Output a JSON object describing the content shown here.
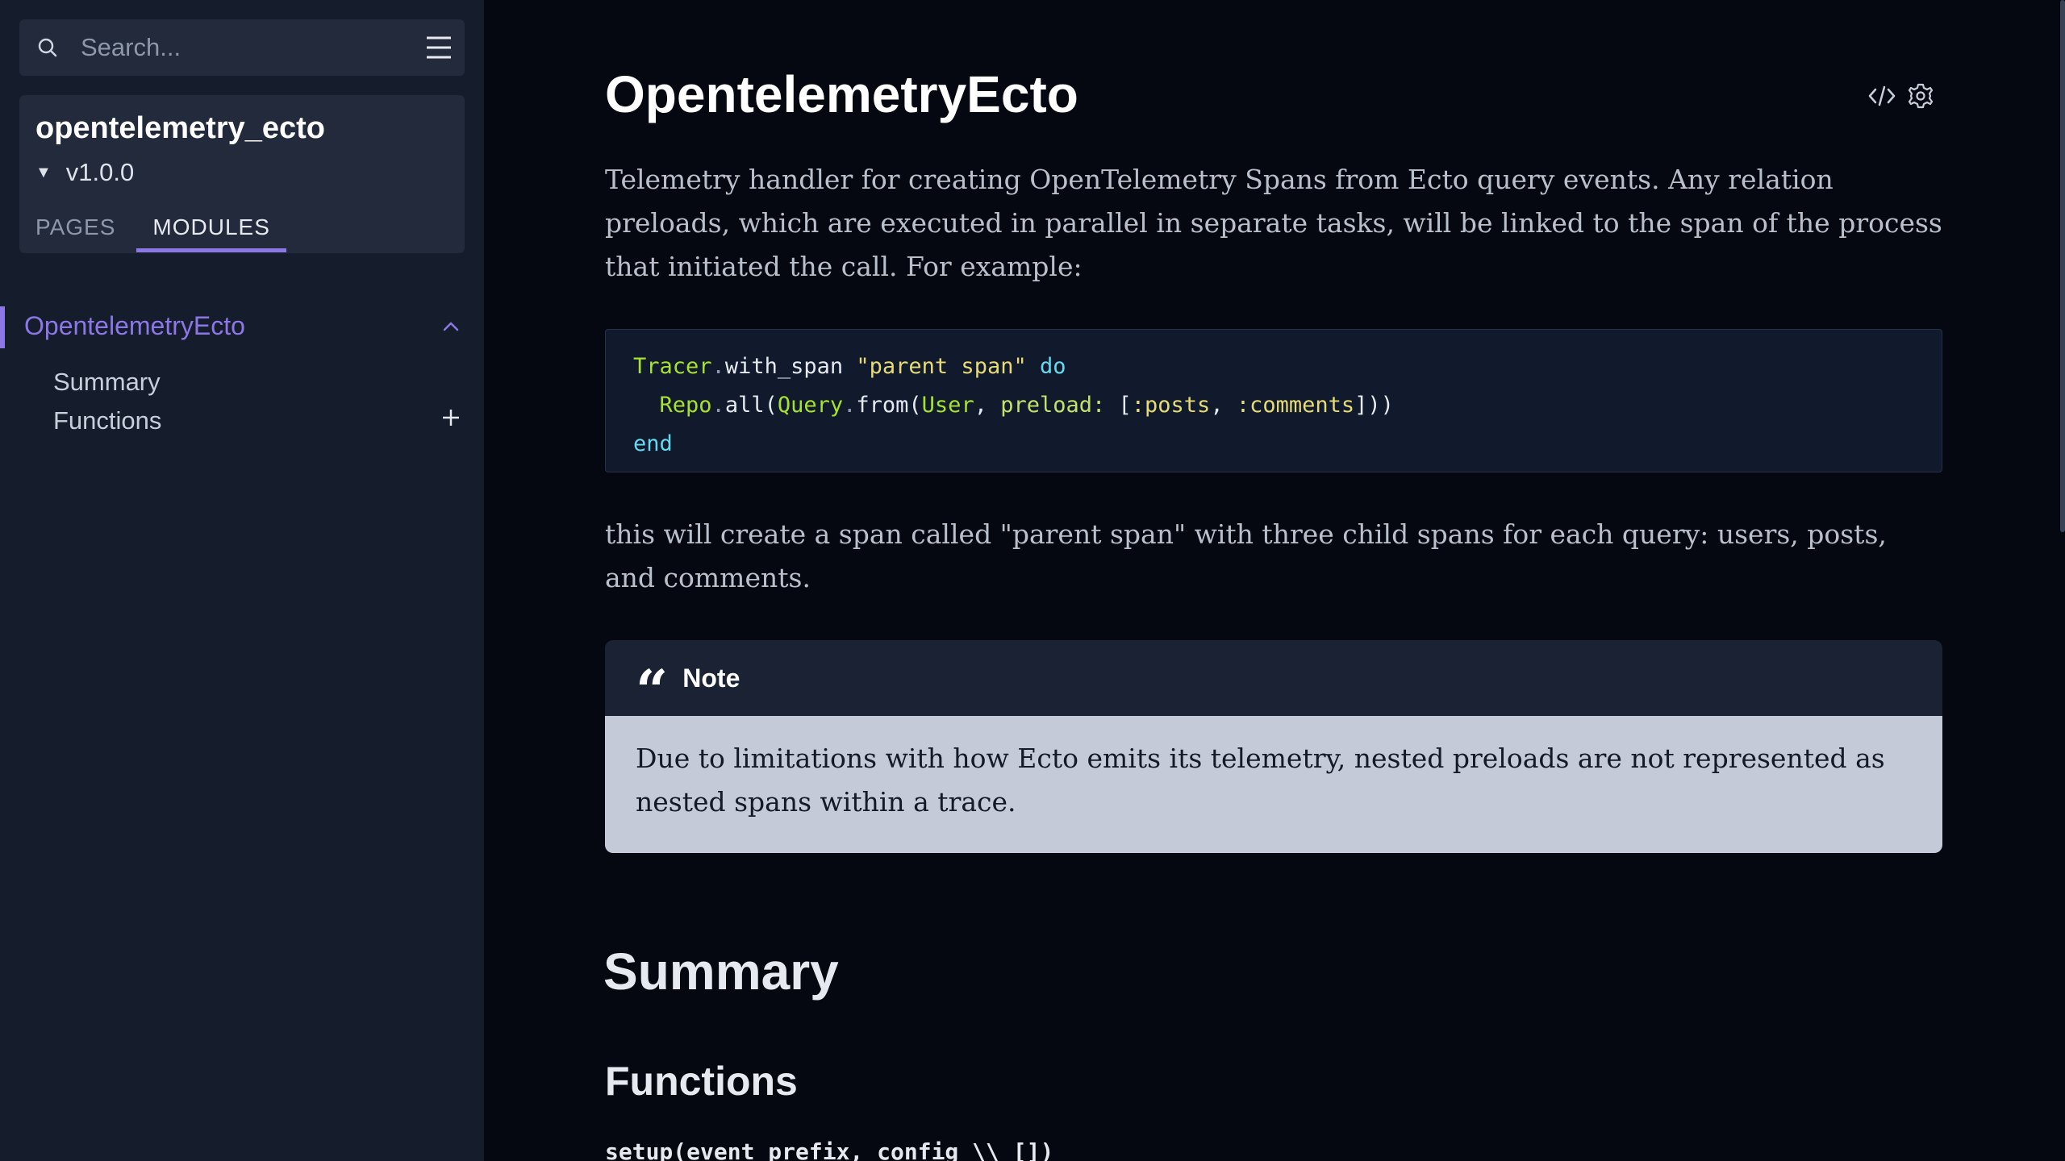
{
  "sidebar": {
    "search_placeholder": "Search...",
    "project_name": "opentelemetry_ecto",
    "version": "v1.0.0",
    "tabs": {
      "pages": "PAGES",
      "modules": "MODULES"
    },
    "module": "OpentelemetryEcto",
    "items": [
      {
        "label": "Summary"
      },
      {
        "label": "Functions"
      }
    ]
  },
  "content": {
    "title": "OpentelemetryEcto",
    "intro": "Telemetry handler for creating OpenTelemetry Spans from Ecto query events. Any relation preloads, which are executed in parallel in separate tasks, will be linked to the span of the process that initiated the call. For example:",
    "code": {
      "l1_mod": "Tracer",
      "l1_fn": "with_span",
      "l1_str": "\"parent span\"",
      "l1_kw": "do",
      "l2_mod": "Repo",
      "l2_fn": "all(",
      "l2_mod2": "Query",
      "l2_fn2": "from(",
      "l2_mod3": "User",
      "l2_sep": ", ",
      "l2_key": "preload:",
      "l2_open": " [",
      "l2_atom1": ":posts",
      "l2_comma": ", ",
      "l2_atom2": ":comments",
      "l2_close": "]))",
      "l3_kw": "end"
    },
    "after_code": "this will create a span called \"parent span\" with three child spans for each query: users, posts, and comments.",
    "note": {
      "label": "Note",
      "body": "Due to limitations with how Ecto emits its telemetry, nested preloads are not represented as nested spans within a trace."
    },
    "summary_heading": "Summary",
    "functions_heading": "Functions",
    "function_signature": "setup(event_prefix, config \\\\ [])"
  },
  "colors": {
    "accent": "#8b78e6",
    "sidebar_bg": "#151c2c",
    "main_bg": "#050810",
    "note_body_bg": "#c5cad8"
  }
}
